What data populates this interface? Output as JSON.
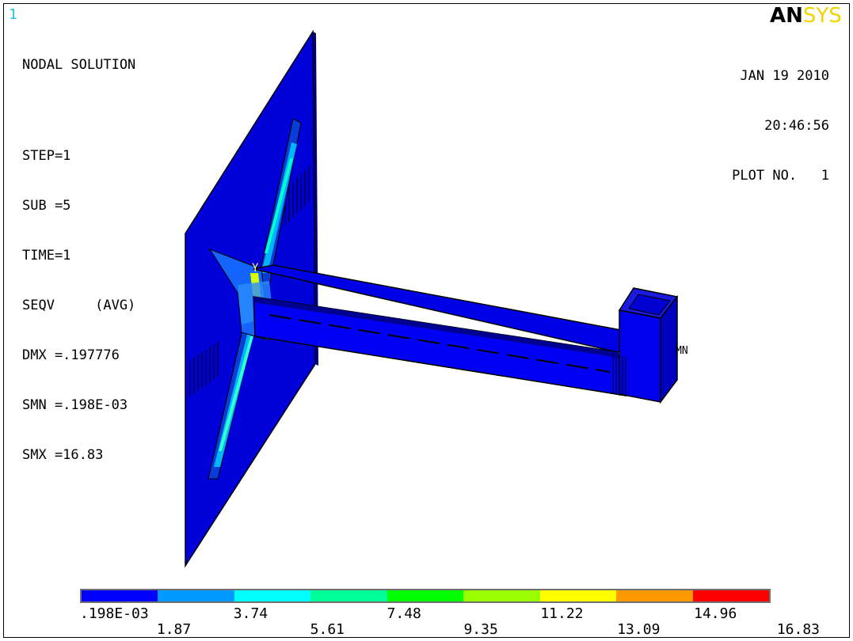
{
  "window_number": "1",
  "info_lines": [
    "NODAL SOLUTION",
    "",
    "STEP=1",
    "SUB =5",
    "TIME=1",
    "SEQV     (AVG)",
    "DMX =.197776",
    "SMN =.198E-03",
    "SMX =16.83"
  ],
  "logo": {
    "part1": "AN",
    "part2": "SYS"
  },
  "stamp": {
    "date": "JAN 19 2010",
    "time": "20:46:56",
    "plot": "PLOT NO.   1"
  },
  "view_markers": {
    "axis_label": "Y",
    "min_label": "MN"
  },
  "legend": {
    "colors": [
      "#0000ff",
      "#0099ff",
      "#00ffff",
      "#00ff99",
      "#00ff00",
      "#99ff00",
      "#ffff00",
      "#ff9900",
      "#ff0000"
    ],
    "labels_top": [
      ".198E-03",
      "3.74",
      "7.48",
      "11.22",
      "14.96"
    ],
    "labels_bottom": [
      "1.87",
      "5.61",
      "9.35",
      "13.09",
      "16.83"
    ]
  }
}
